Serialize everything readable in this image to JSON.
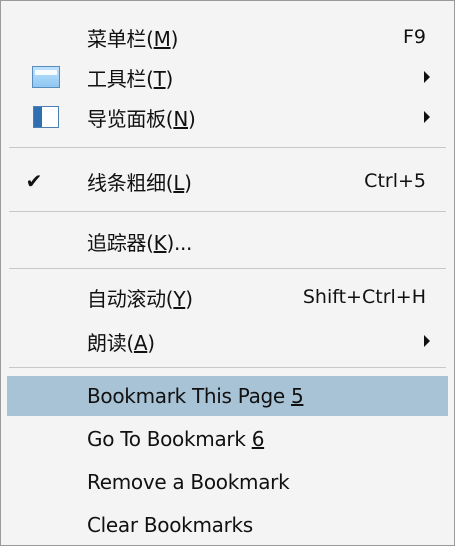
{
  "menu": {
    "items": [
      {
        "label": "菜单栏(",
        "mnemonic": "M",
        "label_end": ")",
        "shortcut": "F9"
      },
      {
        "label": "工具栏(",
        "mnemonic": "T",
        "label_end": ")",
        "icon": "toolbar-icon",
        "submenu": true
      },
      {
        "label": "导览面板(",
        "mnemonic": "N",
        "label_end": ")",
        "icon": "navigation-panel-icon",
        "submenu": true
      },
      {
        "label": "线条粗细(",
        "mnemonic": "L",
        "label_end": ")",
        "shortcut": "Ctrl+5",
        "checked": true,
        "check_icon": "checkmark-icon"
      },
      {
        "label": "追踪器(",
        "mnemonic": "K",
        "label_end": ")..."
      },
      {
        "label": "自动滚动(",
        "mnemonic": "Y",
        "label_end": ")",
        "shortcut": "Shift+Ctrl+H"
      },
      {
        "label": "朗读(",
        "mnemonic": "A",
        "label_end": ")",
        "submenu": true
      },
      {
        "label": "Bookmark This Page ",
        "mnemonic": "5",
        "label_end": "",
        "highlighted": true
      },
      {
        "label": "Go To Bookmark ",
        "mnemonic": "6",
        "label_end": ""
      },
      {
        "label": "Remove a Bookmark",
        "mnemonic": "",
        "label_end": ""
      },
      {
        "label": "Clear Bookmarks",
        "mnemonic": "",
        "label_end": ""
      }
    ],
    "check_glyph": "✔",
    "highlight_color": "#a9c3d6"
  }
}
